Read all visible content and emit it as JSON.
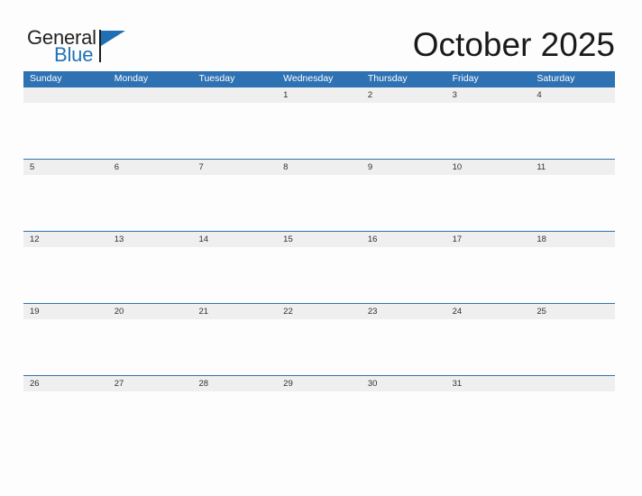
{
  "brand": {
    "logo_text_top": "General",
    "logo_text_bottom": "Blue",
    "accent_color": "#1f72b8",
    "flag_color": "#1f6fb4"
  },
  "header": {
    "title": "October 2025",
    "header_bg_color": "#2f72b4",
    "header_text_color": "#ffffff"
  },
  "calendar": {
    "weekdays": [
      "Sunday",
      "Monday",
      "Tuesday",
      "Wednesday",
      "Thursday",
      "Friday",
      "Saturday"
    ],
    "date_band_color": "#efefef",
    "row_rule_color": "#2f72b4",
    "weeks": [
      [
        "",
        "",
        "",
        "1",
        "2",
        "3",
        "4"
      ],
      [
        "5",
        "6",
        "7",
        "8",
        "9",
        "10",
        "11"
      ],
      [
        "12",
        "13",
        "14",
        "15",
        "16",
        "17",
        "18"
      ],
      [
        "19",
        "20",
        "21",
        "22",
        "23",
        "24",
        "25"
      ],
      [
        "26",
        "27",
        "28",
        "29",
        "30",
        "31",
        ""
      ]
    ]
  }
}
